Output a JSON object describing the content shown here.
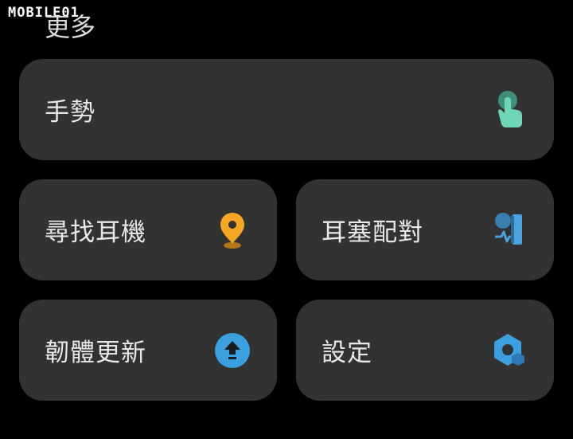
{
  "watermark": "MOBILE01",
  "section": {
    "title": "更多"
  },
  "cards": [
    {
      "label": "手勢",
      "icon": "gesture-hand-icon",
      "color": "#5cc8a8"
    },
    {
      "label": "尋找耳機",
      "icon": "location-pin-icon",
      "color": "#f5a623"
    },
    {
      "label": "耳塞配對",
      "icon": "eartip-fit-icon",
      "color": "#4a9fd8"
    },
    {
      "label": "韌體更新",
      "icon": "firmware-update-icon",
      "color": "#3aa0e0"
    },
    {
      "label": "設定",
      "icon": "settings-hexagon-icon",
      "color": "#3aa0e0"
    }
  ]
}
